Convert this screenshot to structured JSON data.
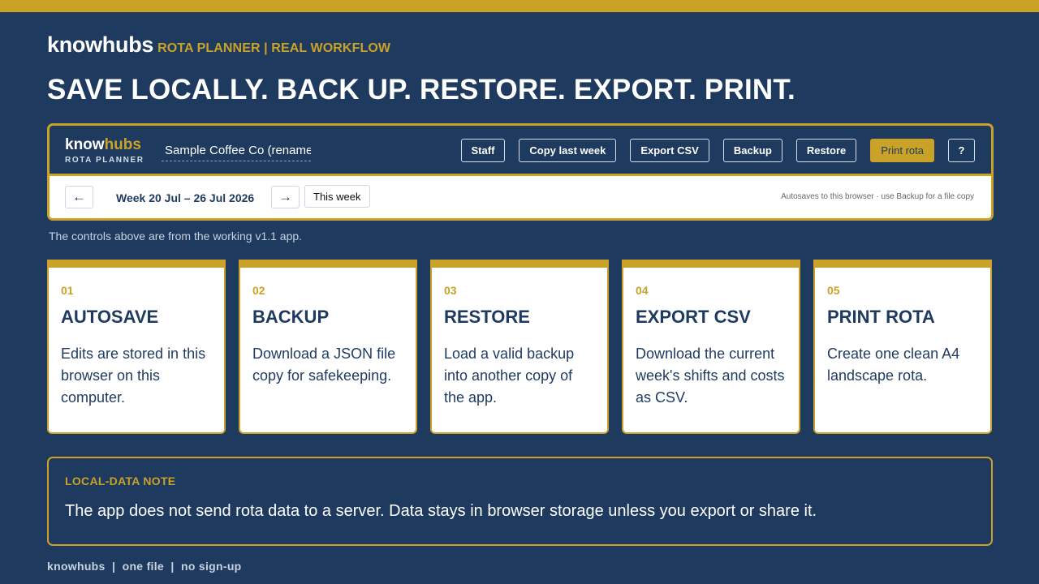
{
  "header": {
    "brand": "knowhubs",
    "tagline": "ROTA PLANNER | REAL WORKFLOW",
    "headline": "SAVE LOCALLY. BACK UP. RESTORE. EXPORT. PRINT."
  },
  "app": {
    "logo_part1": "know",
    "logo_part2": "hubs",
    "logo_sub": "ROTA PLANNER",
    "business_name": "Sample Coffee Co (rename",
    "toolbar": [
      {
        "label": "Staff"
      },
      {
        "label": "Copy last week"
      },
      {
        "label": "Export CSV"
      },
      {
        "label": "Backup"
      },
      {
        "label": "Restore"
      },
      {
        "label": "Print rota"
      },
      {
        "label": "?"
      }
    ],
    "week": {
      "prev_icon": "←",
      "label": "Week 20 Jul – 26 Jul 2026",
      "next_icon": "→",
      "this_week": "This week",
      "autosave_note": "Autosaves to this browser · use Backup for a file copy"
    }
  },
  "caption": "The controls above are from the working v1.1 app.",
  "cards": [
    {
      "num": "01",
      "title": "AUTOSAVE",
      "desc": "Edits are stored in this browser on this computer."
    },
    {
      "num": "02",
      "title": "BACKUP",
      "desc": "Download a JSON file copy for safekeeping."
    },
    {
      "num": "03",
      "title": "RESTORE",
      "desc": "Load a valid backup into another copy of the app."
    },
    {
      "num": "04",
      "title": "EXPORT CSV",
      "desc": "Download the current week's shifts and costs as CSV."
    },
    {
      "num": "05",
      "title": "PRINT ROTA",
      "desc": "Create one clean A4 landscape rota."
    }
  ],
  "note": {
    "label": "LOCAL-DATA NOTE",
    "text": "The app does not send rota data to a server. Data stays in browser storage unless you export or share it."
  },
  "footer": "knowhubs  |  one file  |  no sign-up",
  "colors": {
    "navy": "#1e3a5f",
    "gold": "#c9a227",
    "white": "#ffffff"
  }
}
